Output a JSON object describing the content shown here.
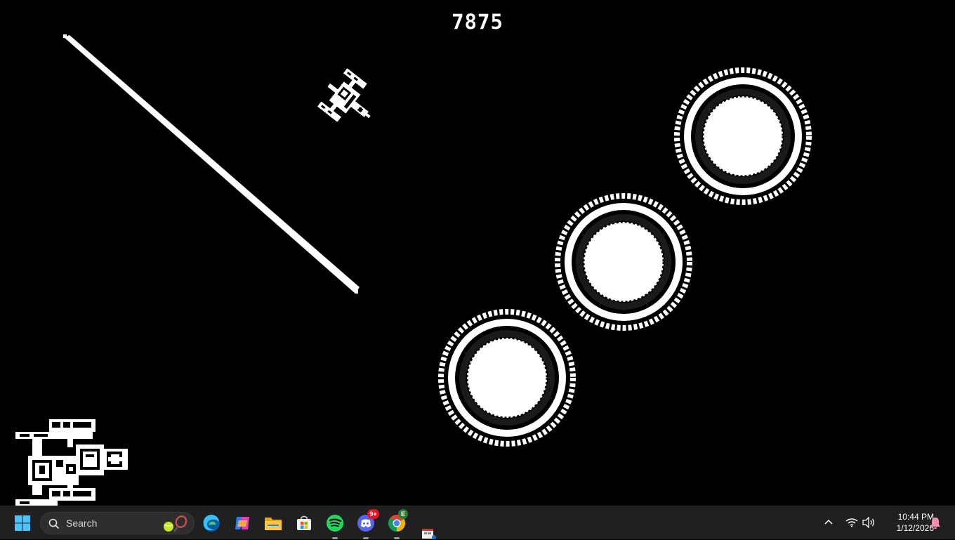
{
  "game": {
    "score": "7875",
    "sprites": {
      "player_ship": "player-ship",
      "enemy_ship": "enemy-ship",
      "laser_beam": "laser-beam",
      "rings": [
        "ring-target",
        "ring-target",
        "ring-target"
      ]
    }
  },
  "taskbar": {
    "search_placeholder": "Search",
    "apps": [
      {
        "name": "Microsoft Edge",
        "icon": "edge-icon"
      },
      {
        "name": "Copilot",
        "icon": "copilot-icon"
      },
      {
        "name": "File Explorer",
        "icon": "folder-icon"
      },
      {
        "name": "Microsoft Store",
        "icon": "store-icon"
      },
      {
        "name": "Spotify",
        "icon": "spotify-icon"
      },
      {
        "name": "Discord",
        "icon": "discord-icon",
        "badge": "9+"
      },
      {
        "name": "Google Chrome",
        "icon": "chrome-icon",
        "badge": "E"
      },
      {
        "name": "Snipping Tool",
        "icon": "snip-icon"
      }
    ],
    "clock": {
      "time": "10:44 PM",
      "date": "1/12/2026"
    },
    "colors": {
      "taskbar": "#202020",
      "windows_blue": "#4cc2ff",
      "spotify": "#1ed760",
      "discord": "#5865f2",
      "badge_red": "#e81123",
      "notification_pink": "#f48fb1"
    }
  }
}
